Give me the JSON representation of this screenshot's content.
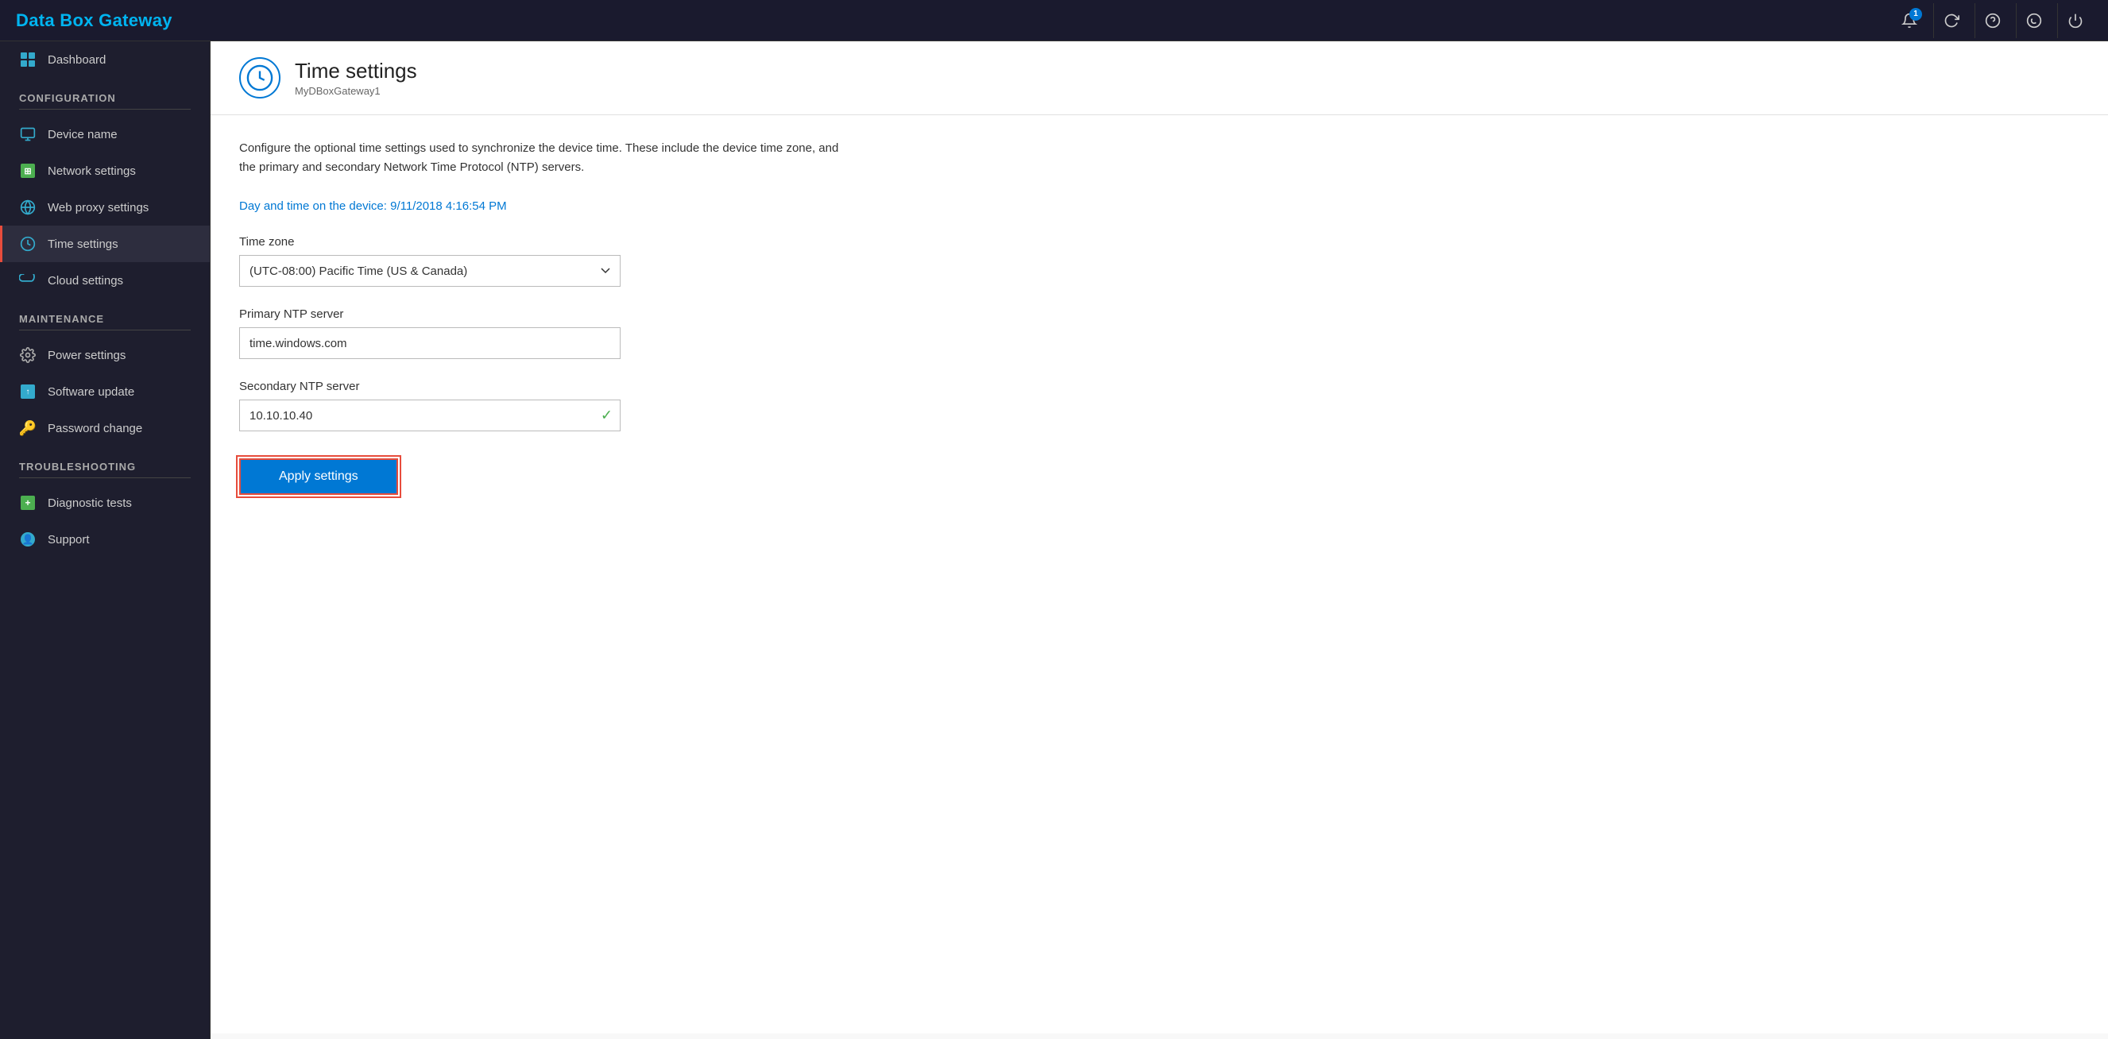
{
  "app": {
    "title": "Data Box Gateway"
  },
  "topbar": {
    "notification_count": "1",
    "icons": [
      "bell",
      "refresh",
      "help",
      "copyright",
      "power"
    ]
  },
  "sidebar": {
    "dashboard_label": "Dashboard",
    "sections": [
      {
        "id": "configuration",
        "label": "CONFIGURATION",
        "items": [
          {
            "id": "device-name",
            "label": "Device name",
            "icon": "device",
            "active": false
          },
          {
            "id": "network-settings",
            "label": "Network settings",
            "icon": "network",
            "active": false
          },
          {
            "id": "web-proxy-settings",
            "label": "Web proxy settings",
            "icon": "globe",
            "active": false
          },
          {
            "id": "time-settings",
            "label": "Time settings",
            "icon": "clock",
            "active": true
          },
          {
            "id": "cloud-settings",
            "label": "Cloud settings",
            "icon": "cloud",
            "active": false
          }
        ]
      },
      {
        "id": "maintenance",
        "label": "MAINTENANCE",
        "items": [
          {
            "id": "power-settings",
            "label": "Power settings",
            "icon": "gear",
            "active": false
          },
          {
            "id": "software-update",
            "label": "Software update",
            "icon": "update",
            "active": false
          },
          {
            "id": "password-change",
            "label": "Password change",
            "icon": "key",
            "active": false
          }
        ]
      },
      {
        "id": "troubleshooting",
        "label": "TROUBLESHOOTING",
        "items": [
          {
            "id": "diagnostic-tests",
            "label": "Diagnostic tests",
            "icon": "diag",
            "active": false
          },
          {
            "id": "support",
            "label": "Support",
            "icon": "support",
            "active": false
          }
        ]
      }
    ]
  },
  "page": {
    "title": "Time settings",
    "subtitle": "MyDBoxGateway1",
    "description_line1": "Configure the optional time settings used to synchronize the device time. These include the device time zone, and",
    "description_line2": "the primary and secondary Network Time Protocol (NTP) servers.",
    "device_time_label": "Day and time on the device: ",
    "device_time_value": "9/11/2018 4:16:54 PM",
    "timezone_label": "Time zone",
    "timezone_value": "(UTC-08:00) Pacific Time (US & Canada)",
    "primary_ntp_label": "Primary NTP server",
    "primary_ntp_value": "time.windows.com",
    "secondary_ntp_label": "Secondary NTP server",
    "secondary_ntp_value": "10.10.10.40",
    "apply_button_label": "Apply settings"
  }
}
